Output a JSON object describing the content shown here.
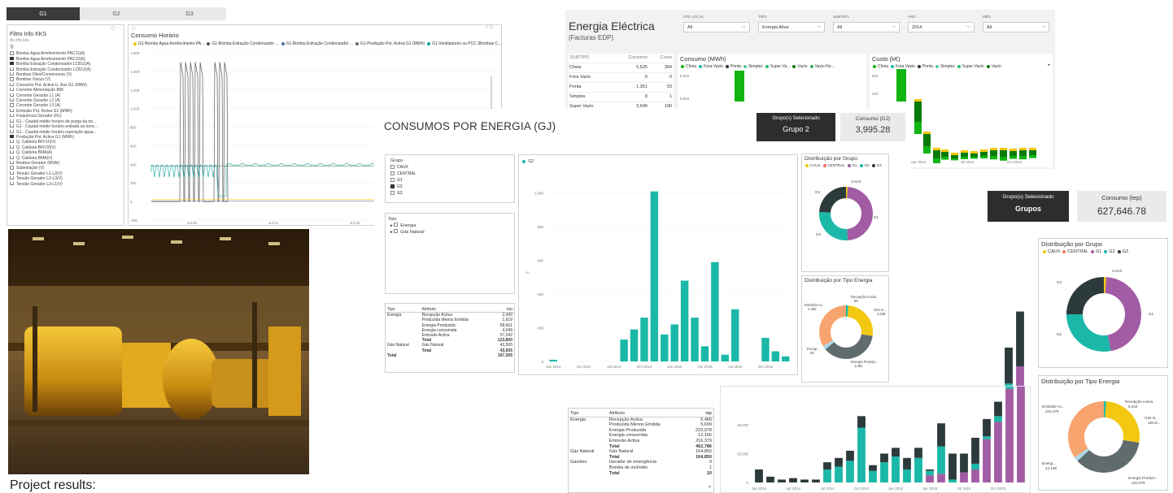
{
  "tabs": [
    "G1",
    "G2",
    "G3"
  ],
  "kks_panel": {
    "title": "Filtro Info KKS",
    "subtitle": "ifs-info kks",
    "items": [
      {
        "label": "Bomba Água Arrefecimento PAC11(A)",
        "checked": false
      },
      {
        "label": "Bomba Água Arrefecimento PAC12(A)",
        "checked": true
      },
      {
        "label": "Bomba Extração Condensador LCB11(A)",
        "checked": true
      },
      {
        "label": "Bomba Extração Condensador LCB12(A)",
        "checked": false
      },
      {
        "label": "Bombas Óleo/Conversores (V)",
        "checked": false
      },
      {
        "label": "Bombas Vácuo (V)",
        "checked": false
      },
      {
        "label": "Consumo Pot. Activa U. Aux G1 (MWh)",
        "checked": false
      },
      {
        "label": "Corrente Alimentação 888",
        "checked": false
      },
      {
        "label": "Corrente Gerador L1 (A)",
        "checked": false
      },
      {
        "label": "Corrente Gerador L2 (A)",
        "checked": false
      },
      {
        "label": "Corrente Gerador L3 (A)",
        "checked": false
      },
      {
        "label": "Emissão Pot. Activa G1 (MWh)",
        "checked": false
      },
      {
        "label": "Frequência Gerador (Hz)",
        "checked": false
      },
      {
        "label": "G1 - Caudal médio horário de purga da tor...",
        "checked": false
      },
      {
        "label": "G1 - Caudal médio horário entrada na torre...",
        "checked": false
      },
      {
        "label": "G1 - Caudal médio horário reposição água...",
        "checked": false
      },
      {
        "label": "Produção Pot. Activa G1 (MWh)",
        "checked": true
      },
      {
        "label": "Q. Caldeira BFF10(V)",
        "checked": false
      },
      {
        "label": "Q. Caldeira BFF20(V)",
        "checked": false
      },
      {
        "label": "Q. Caldeira BMA(A)",
        "checked": false
      },
      {
        "label": "Q. Caldeira BMA(V)",
        "checked": false
      },
      {
        "label": "Reativa Gerador (MVAr)",
        "checked": false
      },
      {
        "label": "Subestação (V)",
        "checked": false
      },
      {
        "label": "Tensão Gerador L1-L2(V)",
        "checked": false
      },
      {
        "label": "Tensão Gerador L2-L3(V)",
        "checked": false
      },
      {
        "label": "Tensão Gerador L3-L1(V)",
        "checked": false
      }
    ]
  },
  "hourly_chart": {
    "title": "Consumo Horário",
    "legend": [
      {
        "name": "G1-Bomba Água Arrefecimento PA...",
        "color": "#f2c811"
      },
      {
        "name": "G1-Bomba Extração Condensador ...",
        "color": "#555555"
      },
      {
        "name": "G1-Bomba Extração Condensador ...",
        "color": "#4a6fa5"
      },
      {
        "name": "G1-Produção Pot. Activa G1 (MWh)",
        "color": "#6a6a6a"
      },
      {
        "name": "G1-Ventiladores ou PCC (Bombas C...",
        "color": "#14a0a0"
      },
      {
        "name": "G1-Ventiladores ou PCC (Bombas C...",
        "color": "#2a7a50"
      }
    ],
    "yticks": [
      "1,600",
      "1,400",
      "1,200",
      "1,000",
      "800",
      "600",
      "400",
      "200",
      "0",
      "-200"
    ],
    "xticks": [
      "Jul 05",
      "Jul 12",
      "Jul 19"
    ]
  },
  "energia_electrica": {
    "title": "Energia Eléctrica",
    "subtitle": "(Facturas EDP)",
    "filters": [
      {
        "label": "CPE LOCAL",
        "value": "All"
      },
      {
        "label": "TIPO",
        "value": "Energia Ativa"
      },
      {
        "label": "SUBTIPO",
        "value": "All"
      },
      {
        "label": "ANO",
        "value": "2014"
      },
      {
        "label": "MÊS",
        "value": "All"
      }
    ],
    "table": {
      "headers": [
        "SUBTIPO",
        "Consumo",
        "Custo"
      ],
      "rows": [
        [
          "Cheia",
          "5,525",
          "354"
        ],
        [
          "Fora Vazio",
          "0",
          "0"
        ],
        [
          "Ponta",
          "1,351",
          "93"
        ],
        [
          "Simples",
          "8",
          "1"
        ],
        [
          "Super Vazio",
          "3,640",
          "190"
        ]
      ]
    },
    "consumo_mwh": {
      "title": "Consumo (MWh)",
      "legend": [
        "Cheia",
        "Fora Vazio",
        "Ponta",
        "Simples",
        "Super Va...",
        "Vazio",
        "Vazio No..."
      ],
      "yticks": [
        "8,000",
        "6,000"
      ]
    },
    "custo_keur": {
      "title": "Custo (k€)",
      "legend": [
        "Cheia",
        "Fora Vazio",
        "Ponta",
        "Simples",
        "Super Vazio",
        "Vazio"
      ],
      "yticks": [
        "500",
        "400"
      ],
      "xticks": [
        "Apr 2014",
        "Jul 2014",
        "Oct 2014"
      ]
    }
  },
  "consumos": {
    "title": "CONSUMOS POR ENERGIA (GJ)",
    "card_group_label": "Grupo(s) Selecionado",
    "card_group_value": "Grupo 2",
    "card_consumo_label": "Consumo (GJ)",
    "card_consumo_value": "3,995.28",
    "grupo_slicer": {
      "title": "Grupo",
      "items": [
        {
          "label": "CAUX",
          "checked": false
        },
        {
          "label": "CENTRAL",
          "checked": false
        },
        {
          "label": "G1",
          "checked": false
        },
        {
          "label": "G2",
          "checked": true
        },
        {
          "label": "G3",
          "checked": false
        }
      ]
    },
    "tipo_slicer": {
      "title": "Tipo",
      "items": [
        "Energia",
        "Gás Natural"
      ]
    },
    "matrix": {
      "headers": [
        "Tipo",
        "Atributo",
        "tep"
      ],
      "rows": [
        [
          "Energia",
          "Recepção Activa",
          "2,430"
        ],
        [
          "",
          "Produzida Menos Emitida",
          "1,619"
        ],
        [
          "",
          "Energia Produzida",
          "58,661"
        ],
        [
          "",
          "Energia consumida",
          "4,048"
        ],
        [
          "",
          "Emissão Activa",
          "57,042"
        ],
        [
          "",
          "Total",
          "123,800"
        ],
        [
          "Gás Natural",
          "Gás Natural",
          "43,505"
        ],
        [
          "",
          "Total",
          "43,505"
        ],
        [
          "Total",
          "",
          "167,305"
        ]
      ]
    },
    "distribuicao_grupo": {
      "title": "Distribuição por Grupo",
      "legend": [
        "CAUX",
        "CENTRAL",
        "G1",
        "G2",
        "G3"
      ],
      "labels": [
        "CAUX",
        "G1",
        "G2",
        "G3"
      ]
    },
    "distribuicao_tipo": {
      "title": "Distribuição por Tipo Energia",
      "labels": [
        "Recepção Activa 59",
        "Gás N... 1,039",
        "Energia Produzi... 1,481",
        "Energi... 92",
        "Emissão Ac... 1,362"
      ]
    }
  },
  "tep_view": {
    "card_group_label": "Grupo(s) Selecionado",
    "card_group_value": "Grupos",
    "card_consumo_label": "Consumo (tep)",
    "card_consumo_value": "627,646.78",
    "distribuicao_grupo": {
      "title": "Distribuição por Grupo",
      "legend": [
        "CAUX",
        "CENTRAL",
        "G1",
        "G2",
        "G3"
      ],
      "labels": [
        "CAUX",
        "G1",
        "G2",
        "G3"
      ]
    },
    "distribuicao_tipo": {
      "title": "Distribuição por Tipo Energia",
      "labels": [
        "Recepção Activa 6,444",
        "Gás N... 164,8...",
        "Energia Produzi... 222,078",
        "Energi... 12,165",
        "Emissão Ac... 216,379"
      ]
    },
    "matrix": {
      "headers": [
        "Tipo",
        "Atributo",
        "tep"
      ],
      "rows": [
        [
          "Energia",
          "Recepção Activa",
          "6,466"
        ],
        [
          "",
          "Produzida Menos Emitida",
          "5,699"
        ],
        [
          "",
          "Energia Produzida",
          "222,078"
        ],
        [
          "",
          "Energia consumida",
          "12,165"
        ],
        [
          "",
          "Emissão Activa",
          "216,379"
        ],
        [
          "",
          "Total",
          "462,786"
        ],
        [
          "Gás Natural",
          "Gás Natural",
          "164,850"
        ],
        [
          "",
          "Total",
          "164,850"
        ],
        [
          "Gasóleo",
          "Gerador de emergência",
          "9"
        ],
        [
          "",
          "Bomba de incêndio",
          "1"
        ],
        [
          "",
          "Total",
          "10"
        ]
      ]
    }
  },
  "caption": "Project results:",
  "colors": {
    "teal": "#1bb8a8",
    "dark": "#2d3a3c",
    "purple": "#a25ca4",
    "yellow": "#f2c811",
    "orange": "#f7a46e",
    "green": "#11b511",
    "grey": "#5f6b6d"
  },
  "chart_data": [
    {
      "type": "bar",
      "title": "",
      "series": [
        {
          "name": "G2",
          "values": [
            10,
            0,
            0,
            0,
            0,
            0,
            0,
            130,
            190,
            260,
            1010,
            160,
            220,
            480,
            260,
            90,
            590,
            40,
            310,
            0,
            0,
            140,
            60,
            30
          ]
        }
      ],
      "categories": [
        "Jan 2014",
        "Feb 2014",
        "Mar 2014",
        "Apr 2014",
        "May 2014",
        "Jun 2014",
        "Jul 2014",
        "Aug 2014",
        "Sep 2014",
        "Oct 2014",
        "Nov 2014",
        "Dec 2014",
        "Jan 2015",
        "Feb 2015",
        "Mar 2015",
        "Apr 2015",
        "May 2015",
        "Jun 2015",
        "Jul 2015",
        "Aug 2015",
        "Sep 2015",
        "Oct 2015",
        "Nov 2015",
        "Dec 2015"
      ],
      "yticks": [
        "1,000",
        "800",
        "600",
        "400",
        "200",
        "0"
      ],
      "xticks": [
        "Jan 2014",
        "Apr 2014",
        "Jul 2014",
        "Oct 2014",
        "Jan 2015",
        "Apr 2015",
        "Jul 2015",
        "Oct 2015"
      ],
      "ylim": [
        0,
        1100
      ]
    },
    {
      "type": "bar",
      "title": "",
      "categories": [
        "Jan 2014",
        "Feb 2014",
        "Mar 2014",
        "Apr 2014",
        "May 2014",
        "Jun 2014",
        "Jul 2014",
        "Aug 2014",
        "Sep 2014",
        "Oct 2014",
        "Nov 2014",
        "Dec 2014",
        "Jan 2015",
        "Feb 2015",
        "Mar 2015",
        "Apr 2015",
        "May 2015",
        "Jun 2015",
        "Jul 2015",
        "Aug 2015",
        "Sep 2015",
        "Oct 2015",
        "Nov 2015",
        "Dec 2015"
      ],
      "series": [
        {
          "name": "G1",
          "values": [
            0,
            0,
            0,
            0,
            0,
            0,
            0,
            0,
            0,
            0,
            0,
            0,
            0,
            0,
            0,
            5000,
            6000,
            0,
            7000,
            9000,
            30000,
            42000,
            65000,
            80000
          ]
        },
        {
          "name": "G2",
          "values": [
            0,
            0,
            0,
            0,
            0,
            0,
            9000,
            11000,
            15000,
            38000,
            8000,
            14000,
            18000,
            9000,
            17000,
            3000,
            19000,
            2000,
            0,
            4000,
            2000,
            4000,
            3000,
            0
          ]
        },
        {
          "name": "G3",
          "values": [
            9000,
            4000,
            2000,
            3000,
            2000,
            2000,
            5000,
            6000,
            7000,
            8000,
            4000,
            6000,
            6000,
            8000,
            7000,
            1000,
            16000,
            18000,
            13000,
            18000,
            12000,
            10000,
            25000,
            38000
          ]
        }
      ],
      "yticks": [
        "40,000",
        "20,000",
        "0"
      ],
      "xticks": [
        "Jan 2014",
        "Apr 2014",
        "Jul 2014",
        "Oct 2014",
        "Jan 2015",
        "Apr 2015",
        "Jul 2015",
        "Oct 2015"
      ],
      "ylim": [
        0,
        125000
      ]
    }
  ]
}
